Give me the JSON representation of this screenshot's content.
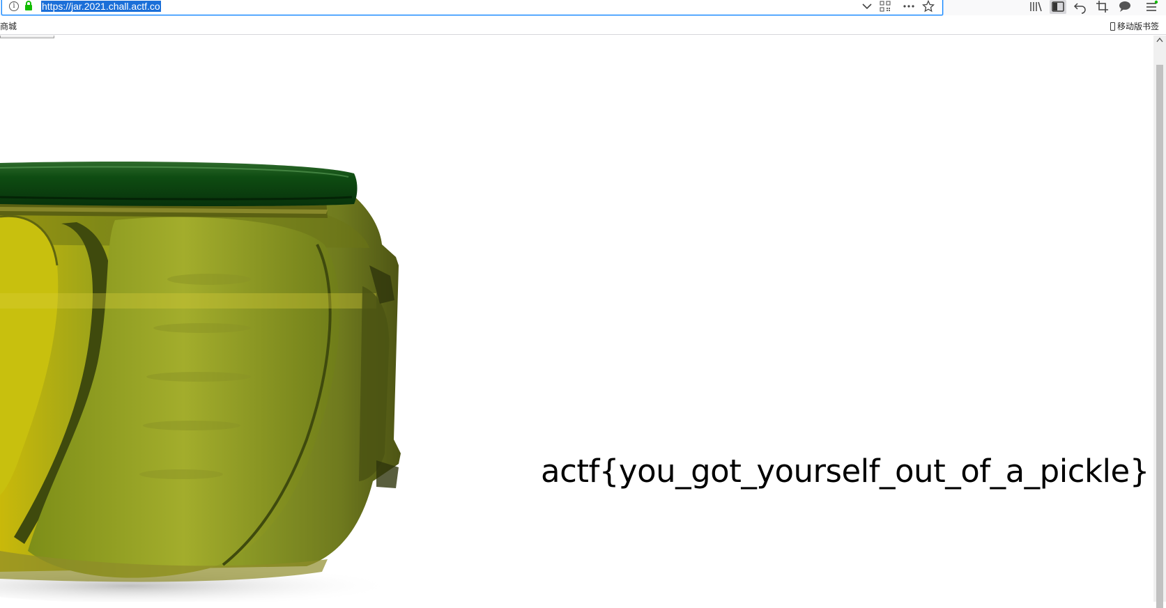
{
  "browser": {
    "url": "https://jar.2021.chall.actf.co",
    "info_icon_glyph": "i",
    "toolbar_icons": [
      "library-icon",
      "sidebar-icon",
      "undo-icon",
      "screenshot-crop-icon",
      "chat-icon",
      "menu-icon"
    ]
  },
  "bookmarks": {
    "left_item": "商城",
    "right_item": "移动版书签"
  },
  "page": {
    "flag_text": "actf{you_got_yourself_out_of_a_pickle}",
    "image_alt": "pickle jar"
  },
  "colors": {
    "url_highlight": "#1b6fd8",
    "focus_border": "#0a84ff",
    "jar_lid": "#0d4a12",
    "pickle": "#8a9b1e"
  }
}
